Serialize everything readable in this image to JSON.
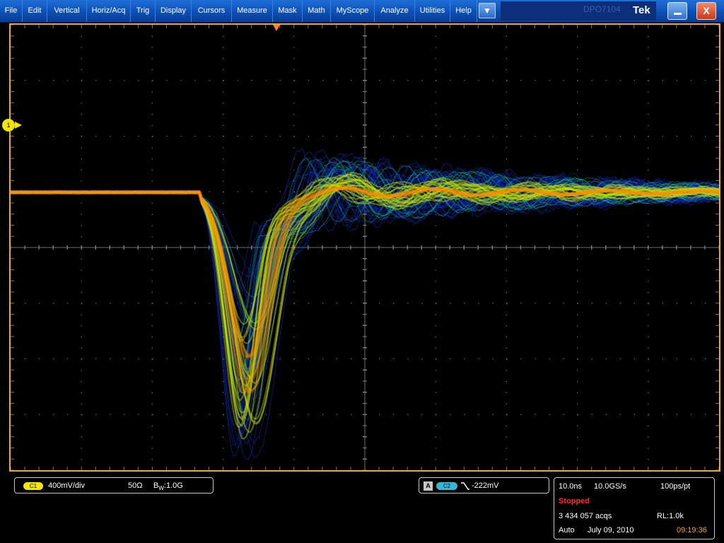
{
  "menubar": {
    "items": [
      "File",
      "Edit",
      "Vertical",
      "Horiz/Acq",
      "Trig",
      "Display",
      "Cursors",
      "Measure",
      "Mask",
      "Math",
      "MyScope",
      "Analyze",
      "Utilities",
      "Help"
    ],
    "dropdown_symbol": "▼",
    "ghost_text": "DPO7104",
    "brand": "Tek",
    "minimize_icon": "minimize-icon",
    "close_symbol": "X"
  },
  "display": {
    "trace_style": "color-graded persistence",
    "grid_color": "#7a7a7a",
    "border_color": "#f5a623",
    "channel_marker": "1"
  },
  "ch1_panel": {
    "badge": "C1",
    "scale": "400mV/div",
    "impedance": "50Ω",
    "bandwidth_prefix": "B",
    "bandwidth_sub": "W",
    "bandwidth_value": ":1.0G"
  },
  "trigger_panel": {
    "badge_a": "A",
    "badge_source": "C2",
    "slope_icon": "falling-edge-icon",
    "level": "-222mV"
  },
  "acquisition_panel": {
    "time_per_div": "10.0ns",
    "sample_rate": "10.0GS/s",
    "resolution": "100ps/pt",
    "state": "Stopped",
    "state_color": "#ff2a2a",
    "acquisitions": "3 434 057 acqs",
    "record_length": "RL:1.0k",
    "mode": "Auto",
    "date": "July 09, 2010",
    "time": "09:19:36",
    "time_color": "#f5a623"
  }
}
